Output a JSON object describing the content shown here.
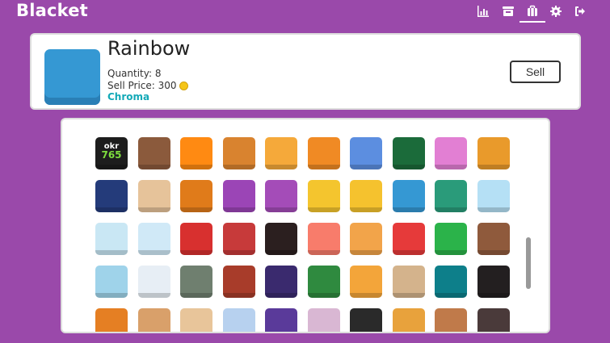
{
  "app": {
    "title": "Blacket"
  },
  "nav": [
    {
      "name": "stats-icon"
    },
    {
      "name": "market-icon"
    },
    {
      "name": "blooks-icon"
    },
    {
      "name": "settings-icon"
    },
    {
      "name": "logout-icon"
    }
  ],
  "selected": {
    "name": "Rainbow",
    "quantity": "Quantity: 8",
    "sell_price": "Sell Price: 300",
    "rarity": "Chroma",
    "color": "#3598d3"
  },
  "sell_label": "Sell",
  "blooks": [
    [
      "#1d1d1d",
      "#8b5a3c",
      "#ff8a12",
      "#d9832f",
      "#f5a93a",
      "#f08a24",
      "#5c8ee0",
      "#1b6b3a",
      "#e27fd3",
      "#e99a2b"
    ],
    [
      "#243b7a",
      "#e6c39a",
      "#e07b1a",
      "#9b45b6",
      "#a44cb8",
      "#f4c52e",
      "#f5c22e",
      "#3598d3",
      "#2a9b7a",
      "#b5e0f5"
    ],
    [
      "#c9e7f4",
      "#d0e9f7",
      "#d8302f",
      "#c73a3a",
      "#2b1f1f",
      "#f87c6b",
      "#f2a44a",
      "#e63a3a",
      "#2bb34a",
      "#8f5a3c"
    ],
    [
      "#9fd3ea",
      "#e7eef5",
      "#6f7f6f",
      "#a83c2a",
      "#3a2a6e",
      "#2f8a3f",
      "#f3a53a",
      "#d4b38c",
      "#0d7f8a",
      "#231f20"
    ],
    [
      "#e57f23",
      "#d9a06a",
      "#e8c59a",
      "#b7d1ef",
      "#5a3a9a",
      "#d9b7d3",
      "#2a2a2a",
      "#e8a23c",
      "#c07a4a",
      "#4a3a3a"
    ]
  ],
  "okr_text": [
    "okr",
    "765"
  ],
  "scroll": {
    "position": 0.22
  }
}
